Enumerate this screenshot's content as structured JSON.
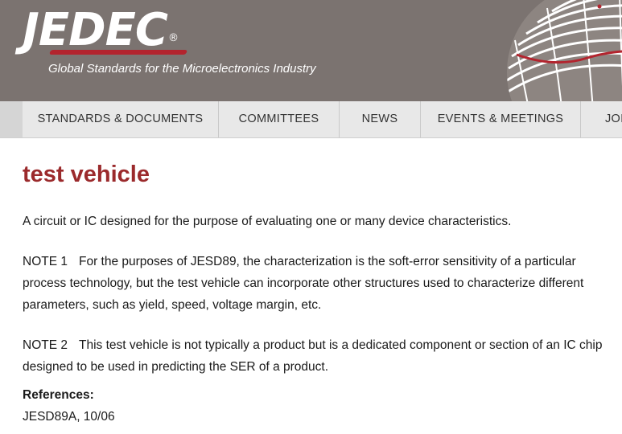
{
  "header": {
    "logo_text": "JEDEC",
    "registered_mark": "®",
    "tagline": "Global Standards for the Microelectronics Industry",
    "colors": {
      "background": "#7b7370",
      "accent": "#b3242e"
    }
  },
  "nav": {
    "items": [
      {
        "label": "STANDARDS & DOCUMENTS"
      },
      {
        "label": "COMMITTEES"
      },
      {
        "label": "NEWS"
      },
      {
        "label": "EVENTS & MEETINGS"
      },
      {
        "label": "JOIN"
      }
    ]
  },
  "term": {
    "title": "test vehicle",
    "definition": "A circuit or IC designed for the purpose of evaluating one or many device characteristics.",
    "notes": [
      {
        "label": "NOTE 1",
        "text": "For the purposes of JESD89, the characterization is the soft-error sensitivity of a particular process technology, but the test vehicle can incorporate other structures used to characterize different parameters, such as yield, speed, voltage margin, etc."
      },
      {
        "label": "NOTE 2",
        "text": "This test vehicle is not typically a product but is a dedicated component or section of an IC chip designed to be used in predicting the SER of a product."
      }
    ],
    "references_heading": "References:",
    "references": [
      "JESD89A, 10/06"
    ],
    "title_color": "#9b2a2c"
  }
}
